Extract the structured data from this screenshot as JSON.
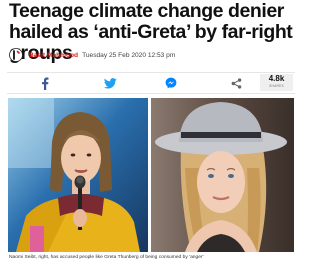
{
  "article": {
    "headline": "Teenage climate change denier hailed as ‘anti-Greta’ by far-right groups",
    "author": "Basit Mahmood",
    "date": "Tuesday 25 Feb 2020 12:53 pm"
  },
  "share_bar": {
    "buttons": [
      {
        "name": "facebook",
        "icon": "facebook-icon"
      },
      {
        "name": "twitter",
        "icon": "twitter-icon"
      },
      {
        "name": "messenger",
        "icon": "messenger-icon"
      },
      {
        "name": "share",
        "icon": "share-icon"
      }
    ],
    "count": "4.8k",
    "count_label": "SHARES"
  },
  "caption": "Naomi Seibt, right, has accused people like Greta Thunberg of being consumed by 'anger'",
  "colors": {
    "brand_red": "#d5201f",
    "facebook": "#3b5998",
    "twitter": "#1da1f2",
    "messenger": "#0084ff"
  }
}
